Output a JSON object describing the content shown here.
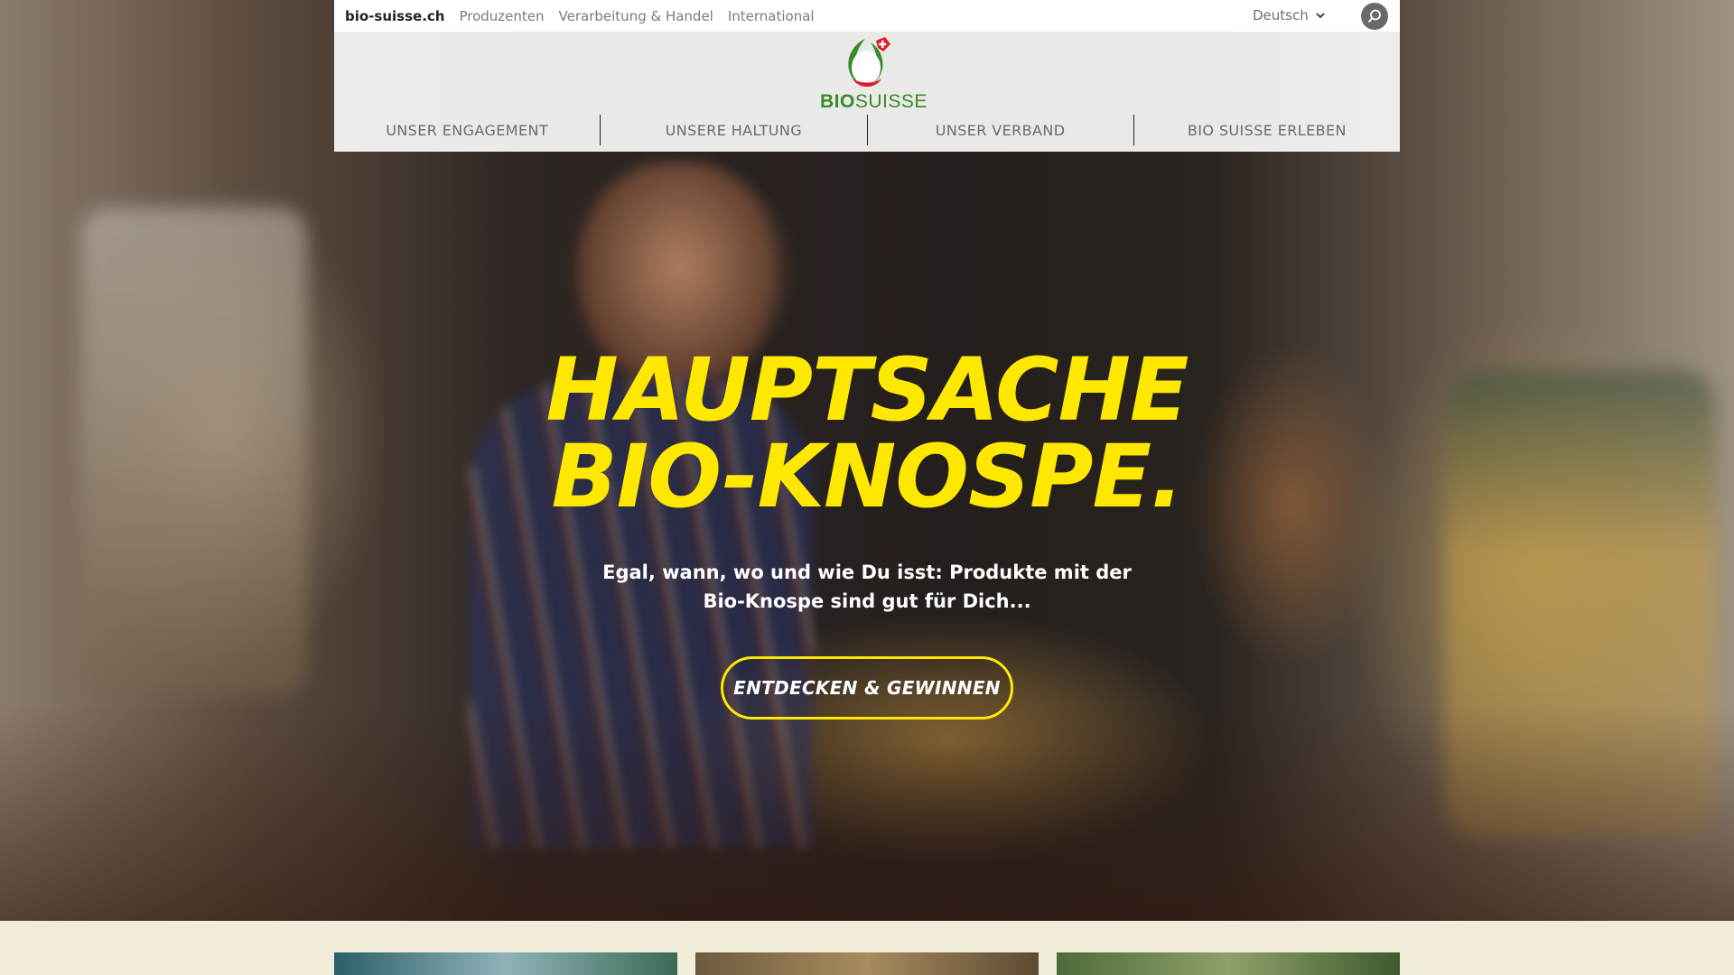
{
  "topbar": {
    "links": [
      "bio-suisse.ch",
      "Produzenten",
      "Verarbeitung & Handel",
      "International"
    ],
    "language": "Deutsch",
    "search_icon": "search-icon"
  },
  "logo": {
    "bio": "BIO",
    "suisse": "SUISSE",
    "colors": {
      "green": "#3a8a2a",
      "red": "#d8202a"
    }
  },
  "nav": {
    "items": [
      "UNSER ENGAGEMENT",
      "UNSERE HALTUNG",
      "UNSER VERBAND",
      "BIO SUISSE ERLEBEN"
    ]
  },
  "hero": {
    "headline_line1": "HAUPTSACHE",
    "headline_line2": "BIO-KNOSPE.",
    "subline_line1": "Egal, wann, wo und wie Du isst: Produkte mit der",
    "subline_line2": "Bio-Knospe sind gut für Dich...",
    "cta": "ENTDECKEN & GEWINNEN",
    "accent": "#ffe800"
  }
}
